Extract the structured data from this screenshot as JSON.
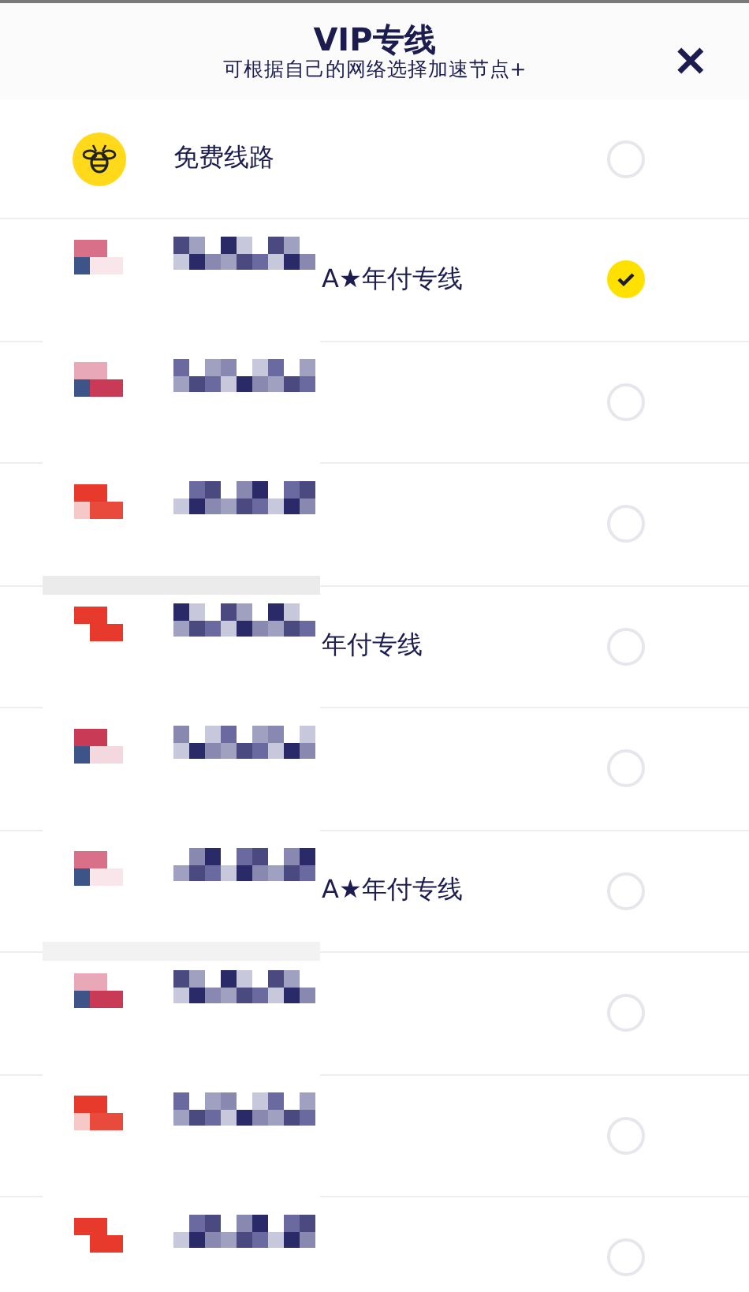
{
  "header": {
    "title": "VIP专线",
    "subtitle": "可根据自己的网络选择加速节点+",
    "close": "✕"
  },
  "lines": [
    {
      "kind": "free",
      "label": "免费线路",
      "selected": false
    },
    {
      "kind": "line",
      "label": "A★年付专线",
      "selected": true
    },
    {
      "kind": "line",
      "selected": false
    },
    {
      "kind": "line",
      "selected": false
    },
    {
      "kind": "line",
      "label": "年付专线",
      "selected": false
    },
    {
      "kind": "line",
      "selected": false
    },
    {
      "kind": "line",
      "label": "A★年付专线",
      "selected": false
    },
    {
      "kind": "line",
      "selected": false
    },
    {
      "kind": "line",
      "selected": false
    },
    {
      "kind": "line",
      "selected": false
    }
  ]
}
